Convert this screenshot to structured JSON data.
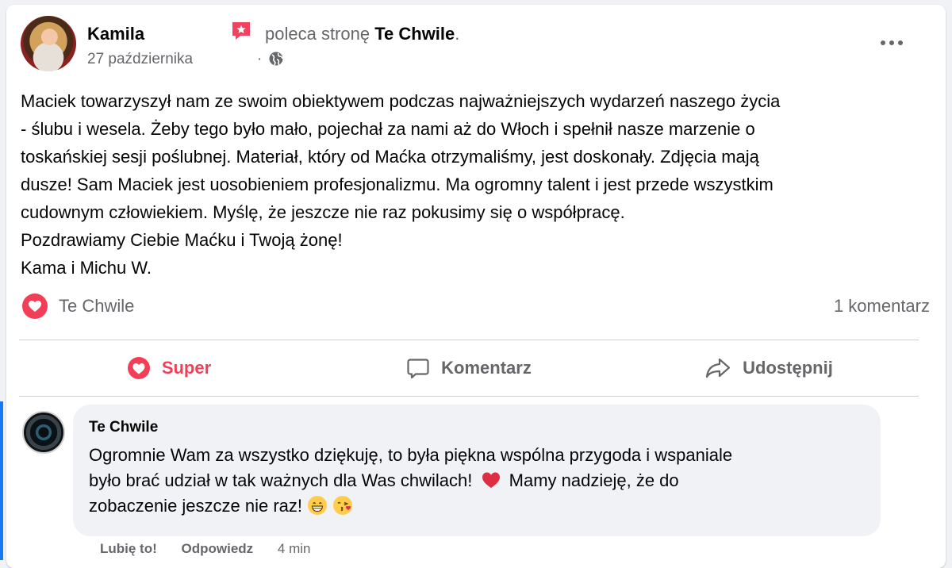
{
  "post": {
    "author": "Kamila",
    "recommendation_prefix": "poleca stronę",
    "page_name": "Te Chwile",
    "recommendation_suffix": ".",
    "date": "27 października",
    "date_separator": "·",
    "audience_icon": "globe-icon",
    "more_icon": "more-dots-icon",
    "text_lines": [
      "Maciek towarzyszył nam ze swoim obiektywem podczas najważniejszych wydarzeń naszego życia",
      "- ślubu i wesela. Żeby tego było mało, pojechał za nami aż do Włoch i spełnił nasze marzenie o",
      "toskańskiej sesji poślubnej. Materiał, który od Maćka otrzymaliśmy, jest doskonały. Zdjęcia mają",
      "dusze! Sam Maciek jest uosobieniem profesjonalizmu. Ma ogromny talent i jest przede wszystkim",
      "cudownym człowiekiem. Myślę, że jeszcze nie raz pokusimy się o współpracę.",
      "Pozdrawiamy Ciebie Maćku i Twoją żonę!",
      "Kama i Michu W."
    ]
  },
  "reactions": {
    "icon": "heart-reaction-icon",
    "name": "Te Chwile",
    "comment_count": "1 komentarz"
  },
  "actions": {
    "like_label": "Super",
    "comment_label": "Komentarz",
    "share_label": "Udostępnij"
  },
  "comment": {
    "author": "Te Chwile",
    "line1": "Ogromnie Wam za wszystko dziękuję, to była piękna wspólna przygoda i wspaniale",
    "line2_a": "było brać udział w tak ważnych dla Was chwilach!",
    "line2_b": "Mamy nadzieję, że do",
    "line3": "zobaczenie jeszcze nie raz!",
    "like_label": "Lubię to!",
    "reply_label": "Odpowiedz",
    "time": "4 min"
  },
  "colors": {
    "reaction_red": "#f33e58",
    "secondary_text": "#65676b",
    "thread_blue": "#1877f2",
    "bubble_bg": "#f0f2f5"
  }
}
